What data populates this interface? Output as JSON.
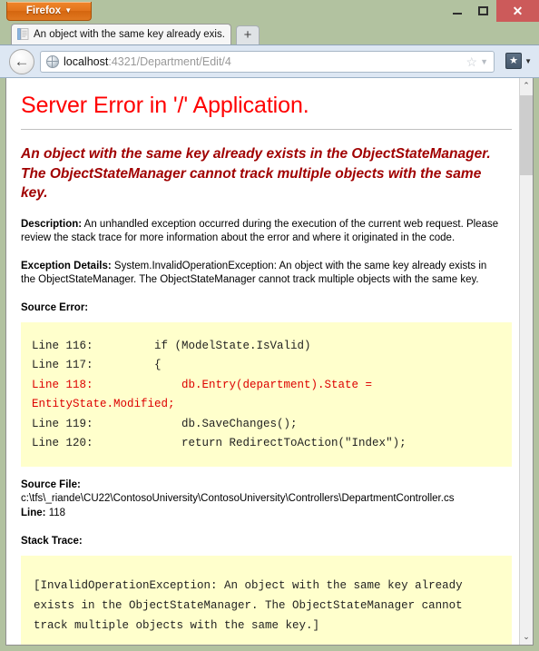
{
  "window": {
    "app_button": "Firefox",
    "app_button_caret": "▼",
    "minimize": "–",
    "maximize": "□",
    "close": "✕"
  },
  "tabs": {
    "items": [
      {
        "title": "An object with the same key already exis...",
        "favicon": "document-icon"
      }
    ],
    "new_tab_label": "+"
  },
  "navbar": {
    "back_label": "←",
    "url_host": "localhost",
    "url_rest": ":4321/Department/Edit/4",
    "url_full": "localhost:4321/Department/Edit/4",
    "star_glyph": "☆",
    "dropdown_glyph": "▼",
    "bookmark_glyph": "★",
    "bookmark_caret": "▼"
  },
  "page": {
    "title": "Server Error in '/' Application.",
    "summary": "An object with the same key already exists in the ObjectStateManager. The ObjectStateManager cannot track multiple objects with the same key.",
    "description_label": "Description:",
    "description_text": "An unhandled exception occurred during the execution of the current web request. Please review the stack trace for more information about the error and where it originated in the code.",
    "exception_label": "Exception Details:",
    "exception_text": "System.InvalidOperationException: An object with the same key already exists in the ObjectStateManager. The ObjectStateManager cannot track multiple objects with the same key.",
    "source_error_heading": "Source Error:",
    "source_code": {
      "before": "Line 116:         if (ModelState.IsValid)\nLine 117:         {\n",
      "highlight": "Line 118:             db.Entry(department).State = EntityState.Modified;",
      "after": "\nLine 119:             db.SaveChanges();\nLine 120:             return RedirectToAction(\"Index\");"
    },
    "source_file_label": "Source File:",
    "source_file_value": "c:\\tfs\\_riande\\CU22\\ContosoUniversity\\ContosoUniversity\\Controllers\\DepartmentController.cs",
    "line_label": "Line:",
    "line_value": "118",
    "stack_trace_heading": "Stack Trace:",
    "stack_trace_text": "[InvalidOperationException: An object with the same key already exists in the ObjectStateManager. The ObjectStateManager cannot track multiple objects with the same key.]"
  },
  "scrollbar": {
    "up_glyph": "⌃",
    "down_glyph": "⌄"
  },
  "colors": {
    "chrome": "#b2c2a0",
    "error_title": "#ff0000",
    "error_summary": "#a00000",
    "code_background": "#ffffcc",
    "highlight": "#dd0000",
    "firefox_orange": "#e2731c",
    "close_red": "#cc5a5a"
  }
}
